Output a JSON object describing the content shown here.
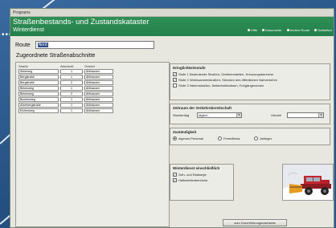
{
  "window": {
    "title": "Programs"
  },
  "header": {
    "title": "Straßenbestands- und Zustandskataster",
    "subtitle": "Winterdienst",
    "nav": [
      "Hilfe",
      "Dokumente",
      "Andere Route",
      "Schließen"
    ]
  },
  "route": {
    "label": "Route",
    "value": "Nord"
  },
  "segments": {
    "title": "Zugeordnete Straßenabschnitte",
    "columns": [
      "Straße",
      "Abschnitt",
      "Ortsteil"
    ],
    "rows": [
      [
        "Ahlerweg",
        "1",
        "Ahlhausen"
      ],
      [
        "Bergstraße",
        "1",
        "Ahlhausen"
      ],
      [
        "Bergstraße",
        "2",
        "Ahlhausen"
      ],
      [
        "Birkenweg",
        "1",
        "Ahlhausen"
      ],
      [
        "Birkenweg",
        "2",
        "Ahlhausen"
      ],
      [
        "Buchenweg",
        "1",
        "Ahlhausen"
      ],
      [
        "Ahlerbergstraße",
        "1",
        "Ahlhausen"
      ],
      [
        "Eichenweg",
        "1",
        "Ahlhausen"
      ]
    ]
  },
  "urgency": {
    "title": "Dringlichkeitsstufe",
    "items": [
      {
        "level": "Stufe 1",
        "text": "Bedeutende Straßen, Gefahrenstellen, Kreuzungsbereiche",
        "checked": true
      },
      {
        "level": "Stufe 2",
        "text": "Wohnsammelstraßen, Strecken des öffentlichen Nahverkehrs",
        "checked": true
      },
      {
        "level": "Stufe 3",
        "text": "Nebenstraßen, Nebenfahrbahnen, Fußgängerzonen",
        "checked": false
      }
    ]
  },
  "timeframe": {
    "title": "Zeitraum der Verkehrsbereitschaft",
    "weekday_label": "Wochentag",
    "weekday_value": "täglich",
    "time_label": "Uhrzeit",
    "time_value": ""
  },
  "responsibility": {
    "title": "Zuständigkeit",
    "options": [
      {
        "label": "eigenes Personal",
        "checked": true
      },
      {
        "label": "Fremdfirma",
        "checked": false
      },
      {
        "label": "Anlieger",
        "checked": false
      }
    ]
  },
  "winter": {
    "title": "Winterdienst einschließlich",
    "options": [
      {
        "label": "Geh- und Radwege",
        "checked": true
      },
      {
        "label": "Haltestellenbereiche",
        "checked": true
      }
    ]
  },
  "photo": {
    "alt": "Schneeräumfahrzeug"
  },
  "button": {
    "label": "zum Durchführungsnachweis"
  },
  "deco": {
    "dots": "••••"
  }
}
